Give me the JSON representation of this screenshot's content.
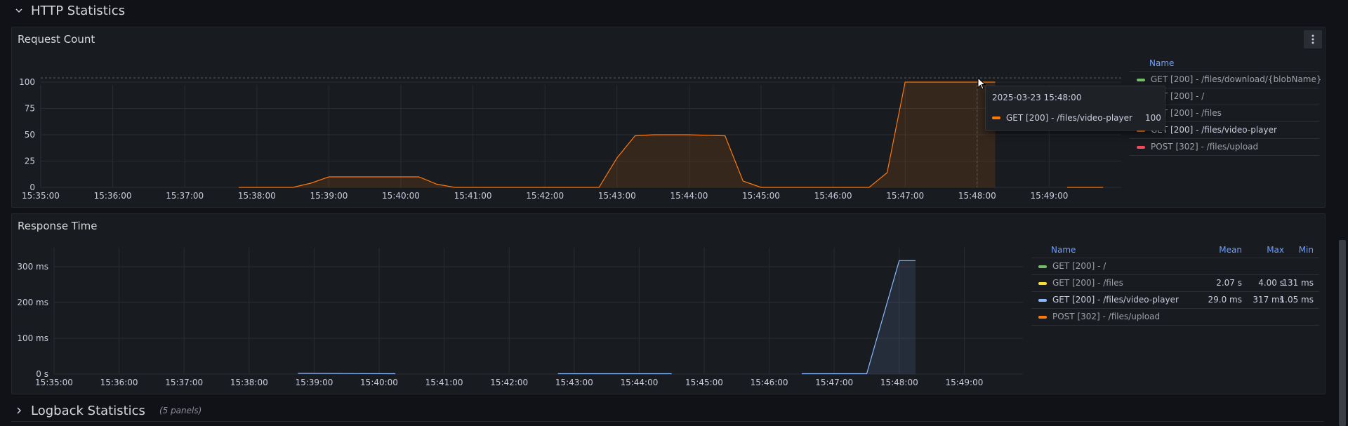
{
  "rows": {
    "http": {
      "title": "HTTP Statistics"
    },
    "logback": {
      "title": "Logback Statistics",
      "subtitle": "(5 panels)"
    }
  },
  "panels": {
    "request_count": {
      "title": "Request Count",
      "legend": {
        "header": "Name",
        "items": [
          {
            "label": "GET [200] - /files/download/{blobName}",
            "color": "#73bf69"
          },
          {
            "label": "GET [200] - /",
            "color": "#fade2a"
          },
          {
            "label": "GET [200] - /files",
            "color": "#5794f2"
          },
          {
            "label": "GET [200] - /files/video-player",
            "color": "#ff780a"
          },
          {
            "label": "POST [302] - /files/upload",
            "color": "#f2495c"
          }
        ]
      },
      "tooltip": {
        "timestamp": "2025-03-23 15:48:00",
        "series": "GET [200] - /files/video-player",
        "value": "100",
        "color": "#ff780a"
      }
    },
    "response_time": {
      "title": "Response Time",
      "legend": {
        "headers": {
          "name": "Name",
          "mean": "Mean",
          "max": "Max",
          "min": "Min"
        },
        "items": [
          {
            "label": "GET [200] - /",
            "color": "#73bf69",
            "mean": "",
            "max": "",
            "min": ""
          },
          {
            "label": "GET [200] - /files",
            "color": "#fade2a",
            "mean": "2.07 s",
            "max": "4.00 s",
            "min": "131 ms"
          },
          {
            "label": "GET [200] - /files/video-player",
            "color": "#8ab8ff",
            "mean": "29.0 ms",
            "max": "317 ms",
            "min": "1.05 ms"
          },
          {
            "label": "POST [302] - /files/upload",
            "color": "#ff780a",
            "mean": "",
            "max": "",
            "min": ""
          }
        ]
      }
    }
  },
  "chart_data": [
    {
      "type": "line",
      "title": "Request Count",
      "x_ticks": [
        "15:35:00",
        "15:36:00",
        "15:37:00",
        "15:38:00",
        "15:39:00",
        "15:40:00",
        "15:41:00",
        "15:42:00",
        "15:43:00",
        "15:44:00",
        "15:45:00",
        "15:46:00",
        "15:47:00",
        "15:48:00",
        "15:49:00"
      ],
      "y_ticks": [
        "0",
        "25",
        "50",
        "75",
        "100"
      ],
      "ylim": [
        0,
        110
      ],
      "grid": true,
      "legend_position": "right",
      "series": [
        {
          "name": "GET [200] - /files/video-player",
          "color": "#ff780a",
          "points": [
            [
              "15:37:45",
              0
            ],
            [
              "15:38:30",
              0
            ],
            [
              "15:38:45",
              4
            ],
            [
              "15:39:00",
              10
            ],
            [
              "15:40:15",
              10
            ],
            [
              "15:40:30",
              3
            ],
            [
              "15:40:45",
              0
            ],
            [
              "15:42:45",
              0
            ],
            [
              "15:43:00",
              28
            ],
            [
              "15:43:15",
              49
            ],
            [
              "15:43:30",
              50
            ],
            [
              "15:44:00",
              50
            ],
            [
              "15:44:30",
              49
            ],
            [
              "15:44:45",
              6
            ],
            [
              "15:45:00",
              0
            ],
            [
              "15:46:30",
              0
            ],
            [
              "15:46:45",
              14
            ],
            [
              "15:47:00",
              100
            ],
            [
              "15:48:15",
              100
            ]
          ],
          "segment_2": [
            [
              "15:49:15",
              0
            ],
            [
              "15:49:45",
              0
            ]
          ]
        }
      ]
    },
    {
      "type": "line",
      "title": "Response Time",
      "x_ticks": [
        "15:35:00",
        "15:36:00",
        "15:37:00",
        "15:38:00",
        "15:39:00",
        "15:40:00",
        "15:41:00",
        "15:42:00",
        "15:43:00",
        "15:44:00",
        "15:45:00",
        "15:46:00",
        "15:47:00",
        "15:48:00",
        "15:49:00"
      ],
      "y_ticks": [
        "0 s",
        "100 ms",
        "200 ms",
        "300 ms"
      ],
      "ylim": [
        0,
        350
      ],
      "y_unit": "ms",
      "grid": true,
      "legend_position": "right",
      "series": [
        {
          "name": "GET [200] - /files/video-player",
          "color": "#8ab8ff",
          "segments": [
            [
              [
                "15:38:45",
                2
              ],
              [
                "15:40:15",
                1
              ]
            ],
            [
              [
                "15:42:45",
                1
              ],
              [
                "15:44:30",
                1
              ]
            ],
            [
              [
                "15:46:30",
                1
              ],
              [
                "15:47:30",
                1
              ],
              [
                "15:48:00",
                317
              ],
              [
                "15:48:15",
                317
              ]
            ]
          ]
        }
      ]
    }
  ]
}
